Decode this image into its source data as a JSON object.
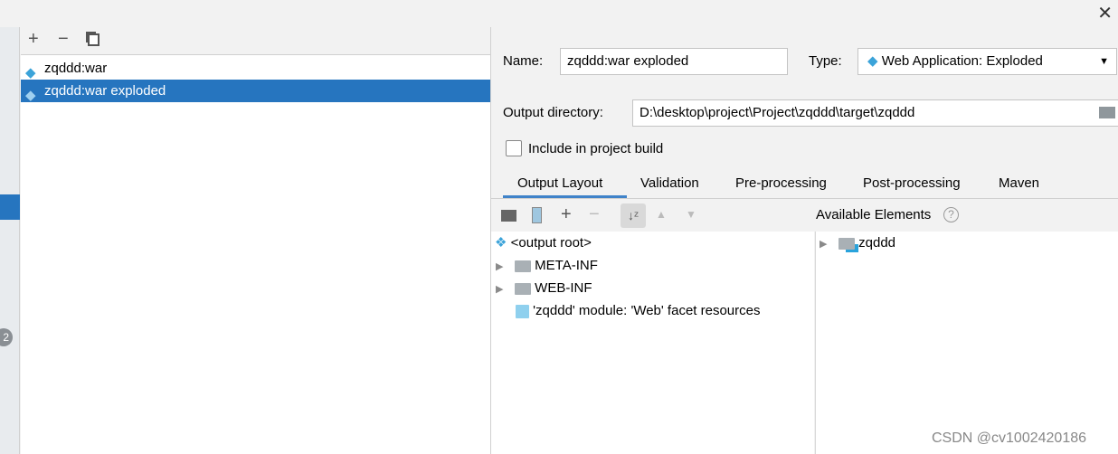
{
  "artifacts": [
    {
      "label": "zqddd:war",
      "selected": false
    },
    {
      "label": "zqddd:war exploded",
      "selected": true
    }
  ],
  "left_badge": "2",
  "form": {
    "name_label": "Name:",
    "name_value": "zqddd:war exploded",
    "type_label": "Type:",
    "type_value": "Web Application: Exploded",
    "output_label": "Output directory:",
    "output_value": "D:\\desktop\\project\\Project\\zqddd\\target\\zqddd",
    "include_label": "Include in project build",
    "include_checked": false
  },
  "tabs": [
    {
      "label": "Output Layout",
      "active": true
    },
    {
      "label": "Validation"
    },
    {
      "label": "Pre-processing"
    },
    {
      "label": "Post-processing"
    },
    {
      "label": "Maven"
    }
  ],
  "layout_tree": [
    {
      "label": "<output root>",
      "icon": "artifact-icon"
    },
    {
      "label": "META-INF",
      "icon": "folder-icon",
      "expandable": true
    },
    {
      "label": "WEB-INF",
      "icon": "folder-icon",
      "expandable": true
    },
    {
      "label": "'zqddd' module: 'Web' facet resources",
      "icon": "web-facet-icon"
    }
  ],
  "available": {
    "title": "Available Elements",
    "items": [
      {
        "label": "zqddd",
        "icon": "module-folder-icon"
      }
    ]
  },
  "watermark": "CSDN @cv1002420186",
  "colors": {
    "selection": "#2675bf",
    "tab_underline": "#4083c9"
  }
}
